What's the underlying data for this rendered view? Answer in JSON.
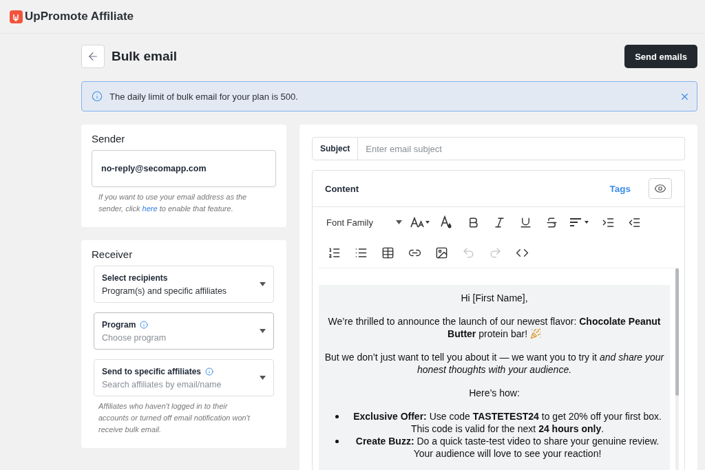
{
  "app": {
    "name": "UpPromote Affiliate"
  },
  "page": {
    "title": "Bulk email",
    "primary_button": "Send emails"
  },
  "notice": {
    "text": "The daily limit of bulk email for your plan is 500.",
    "dismissible": true
  },
  "sender": {
    "title": "Sender",
    "value": "no-reply@secomapp.com",
    "hint_before": "If you want to use your email address as the sender, click ",
    "hint_link": "here",
    "hint_after": " to enable that feature."
  },
  "receiver": {
    "title": "Receiver",
    "fields": [
      {
        "label": "Select recipients",
        "value": "Program(s) and specific affiliates",
        "info": false
      },
      {
        "label": "Program",
        "placeholder": "Choose program",
        "info": true
      },
      {
        "label": "Send to specific affiliates",
        "placeholder": "Search affiliates by email/name",
        "info": true
      }
    ],
    "note": "Affiliates who haven't logged in to their accounts or turned off email notification won't receive bulk email."
  },
  "subject": {
    "label": "Subject",
    "placeholder": "Enter email subject"
  },
  "content": {
    "title": "Content",
    "tags_link": "Tags",
    "toolbar": [
      [
        {
          "kind": "font-family",
          "label": "Font Family",
          "disabled": false
        },
        {
          "kind": "font-size",
          "disabled": false
        },
        {
          "kind": "color",
          "disabled": false
        },
        {
          "kind": "bold",
          "disabled": false
        },
        {
          "kind": "italic",
          "disabled": false
        },
        {
          "kind": "underline",
          "disabled": false
        },
        {
          "kind": "strike",
          "disabled": false
        },
        {
          "kind": "align",
          "disabled": false
        },
        {
          "kind": "indent",
          "disabled": false
        },
        {
          "kind": "outdent",
          "disabled": false
        }
      ],
      [
        {
          "kind": "ordered-list",
          "disabled": false
        },
        {
          "kind": "bullet-list",
          "disabled": false
        },
        {
          "kind": "table",
          "disabled": false
        },
        {
          "kind": "link",
          "disabled": false
        },
        {
          "kind": "image",
          "disabled": false
        },
        {
          "kind": "undo",
          "disabled": true
        },
        {
          "kind": "redo",
          "disabled": true
        },
        {
          "kind": "code",
          "disabled": false
        }
      ]
    ],
    "body": [
      {
        "kind": "paragraph",
        "text": "Hi [First Name],"
      },
      {
        "kind": "paragraph",
        "text": "We’re thrilled to announce the launch of our newest flavor: **Chocolate Peanut Butter** protein bar!",
        "party_icon": true
      },
      {
        "kind": "paragraph",
        "text": "But we don’t just want to tell you about it — we want you to try it *and share your honest thoughts with your audience.*"
      },
      {
        "kind": "paragraph",
        "text": "Here’s how:"
      },
      {
        "kind": "list",
        "items": [
          "**Exclusive Offer:** Use code **TASTETEST24** to get 20% off your first box. This code is valid for the next **24 hours only**.",
          "**Create Buzz:** Do a quick taste-test video to share your genuine review. Your audience will love to see your reaction!"
        ]
      }
    ]
  }
}
